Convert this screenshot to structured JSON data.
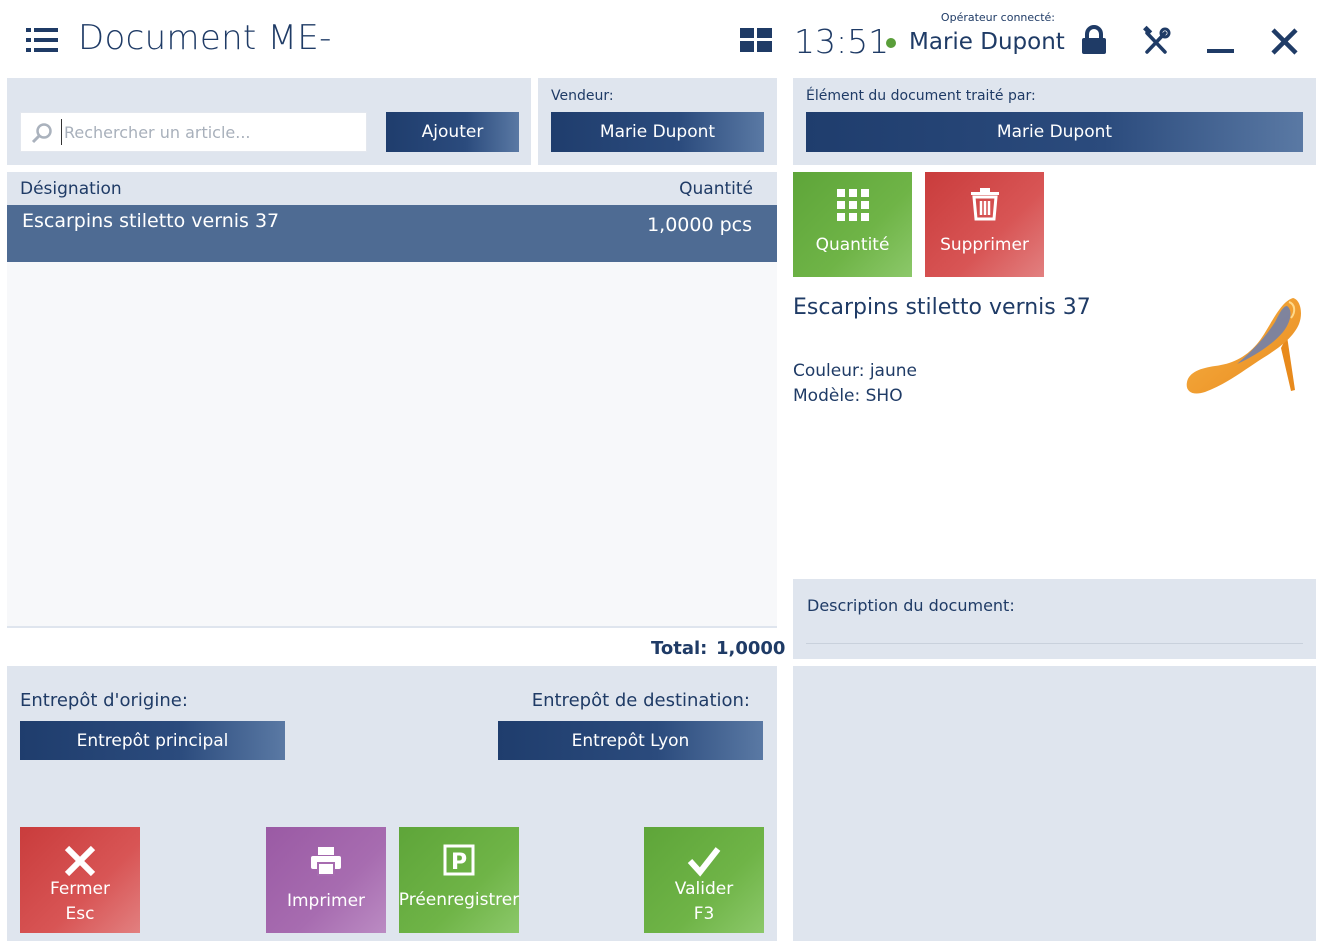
{
  "header": {
    "title": "Document ME-",
    "clock": "13:51",
    "operator_caption": "Opérateur connecté:",
    "operator_name": "Marie Dupont",
    "status_color": "#5a9e3a"
  },
  "icons": {
    "menu": "menu-list-icon",
    "grid": "grid-view-icon",
    "lock": "lock-icon",
    "tools": "tools-icon",
    "minimize": "minimize-icon",
    "close": "close-icon"
  },
  "search": {
    "placeholder": "Rechercher un article...",
    "value": "",
    "add_label": "Ajouter"
  },
  "seller": {
    "label": "Vendeur:",
    "value": "Marie Dupont"
  },
  "processed_by": {
    "label": "Élément du document traité par:",
    "value": "Marie Dupont"
  },
  "items_table": {
    "columns": [
      "Désignation",
      "Quantité"
    ],
    "rows": [
      {
        "designation": "Escarpins stiletto vernis 37",
        "quantity": "1,0000 pcs"
      }
    ],
    "total_label": "Total:",
    "total_value": "1,0000"
  },
  "warehouses": {
    "origin_label": "Entrepôt d'origine:",
    "origin_value": "Entrepôt principal",
    "destination_label": "Entrepôt de destination:",
    "destination_value": "Entrepôt Lyon"
  },
  "item_actions": {
    "quantity": "Quantité",
    "delete": "Supprimer"
  },
  "product": {
    "name": "Escarpins stiletto vernis 37",
    "color": "Couleur: jaune",
    "model": "Modèle: SHO"
  },
  "description": {
    "label": "Description du document:"
  },
  "footer": {
    "close_label": "Fermer",
    "close_key": "Esc",
    "print_label": "Imprimer",
    "preregister_label": "Préenregistrer",
    "validate_label": "Valider",
    "validate_key": "F3"
  },
  "colors": {
    "primary": "#1f3b66",
    "panel": "#dfe5ee",
    "selected_row": "#4e6b93",
    "red": "#d24a4a",
    "purple": "#a76cb0",
    "green": "#6fb447"
  }
}
